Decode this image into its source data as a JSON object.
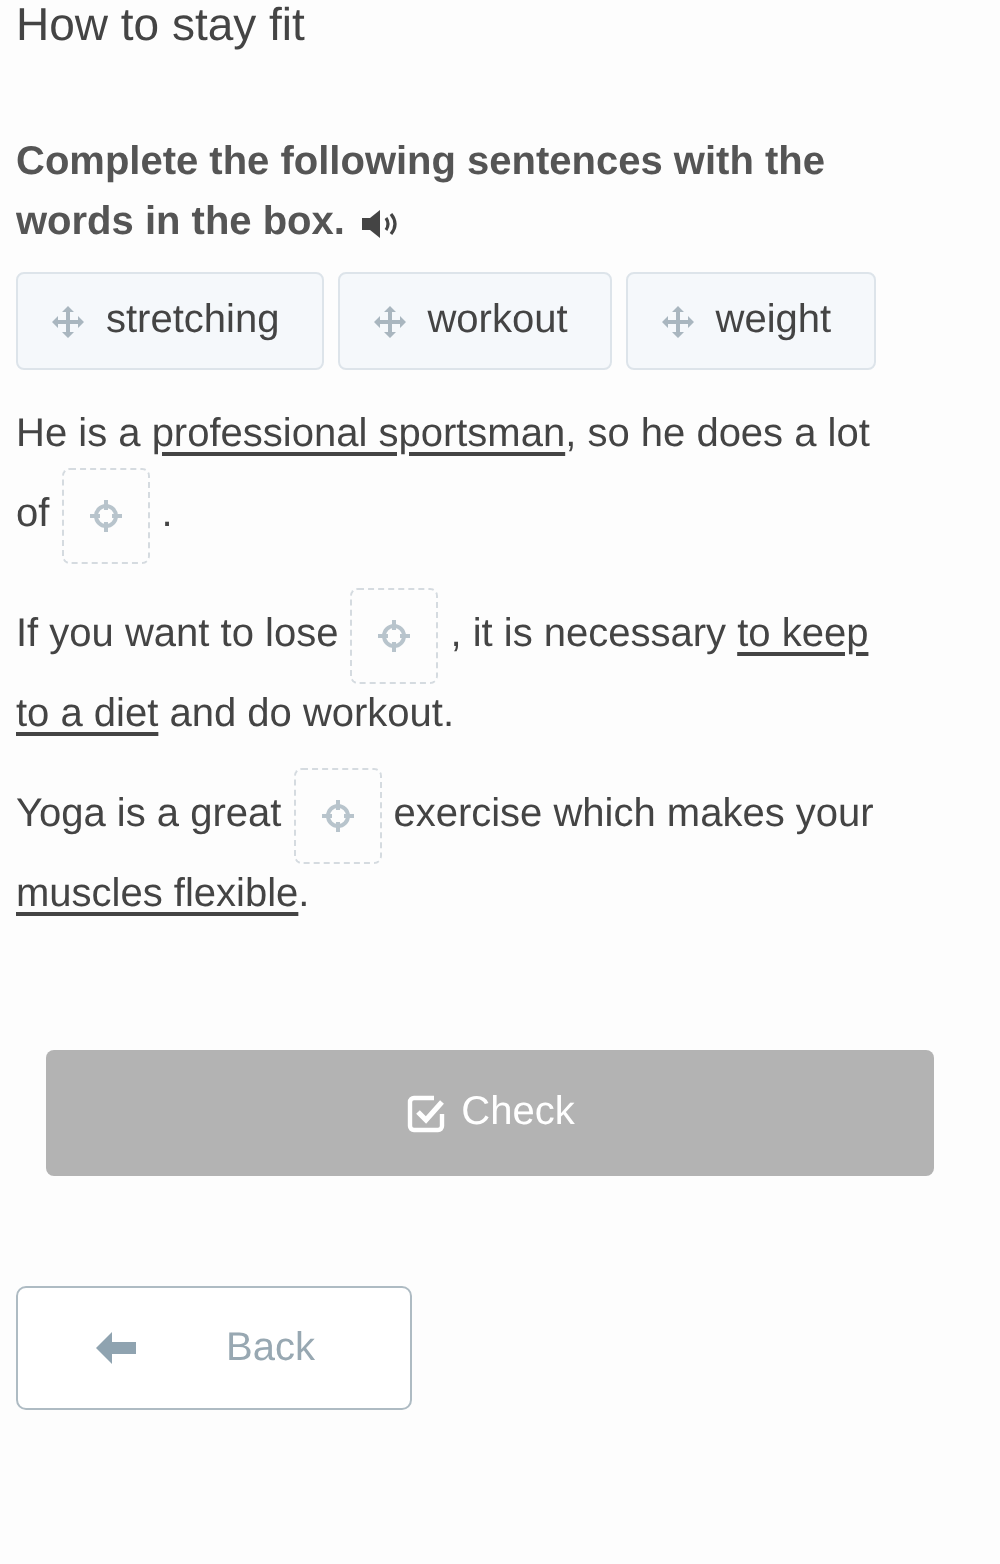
{
  "title": "How to stay fit",
  "instruction_lines": [
    "Complete the following sentences with the",
    "words in the box."
  ],
  "words": [
    {
      "label": "stretching"
    },
    {
      "label": "workout"
    },
    {
      "label": "weight"
    }
  ],
  "sentences": [
    {
      "parts": [
        {
          "kind": "text",
          "text": "He is a "
        },
        {
          "kind": "underlined",
          "text": "professional sportsman"
        },
        {
          "kind": "text",
          "text": ", so he does a lot"
        },
        {
          "kind": "break"
        },
        {
          "kind": "text",
          "text": "of"
        },
        {
          "kind": "blank"
        },
        {
          "kind": "text",
          "text": "."
        }
      ]
    },
    {
      "parts": [
        {
          "kind": "text",
          "text": "If you want to lose"
        },
        {
          "kind": "blank"
        },
        {
          "kind": "text",
          "text": ", it is necessary "
        },
        {
          "kind": "underlined",
          "text": "to keep"
        },
        {
          "kind": "break"
        },
        {
          "kind": "underlined",
          "text": "to a diet"
        },
        {
          "kind": "text",
          "text": " and do workout."
        }
      ]
    },
    {
      "parts": [
        {
          "kind": "text",
          "text": "Yoga is a great"
        },
        {
          "kind": "blank"
        },
        {
          "kind": "text",
          "text": "exercise which makes your"
        },
        {
          "kind": "break"
        },
        {
          "kind": "underlined",
          "text": "muscles flexible"
        },
        {
          "kind": "text",
          "text": "."
        }
      ]
    }
  ],
  "check_button": {
    "label": "Check",
    "disabled": true
  },
  "back_button": {
    "label": "Back"
  }
}
